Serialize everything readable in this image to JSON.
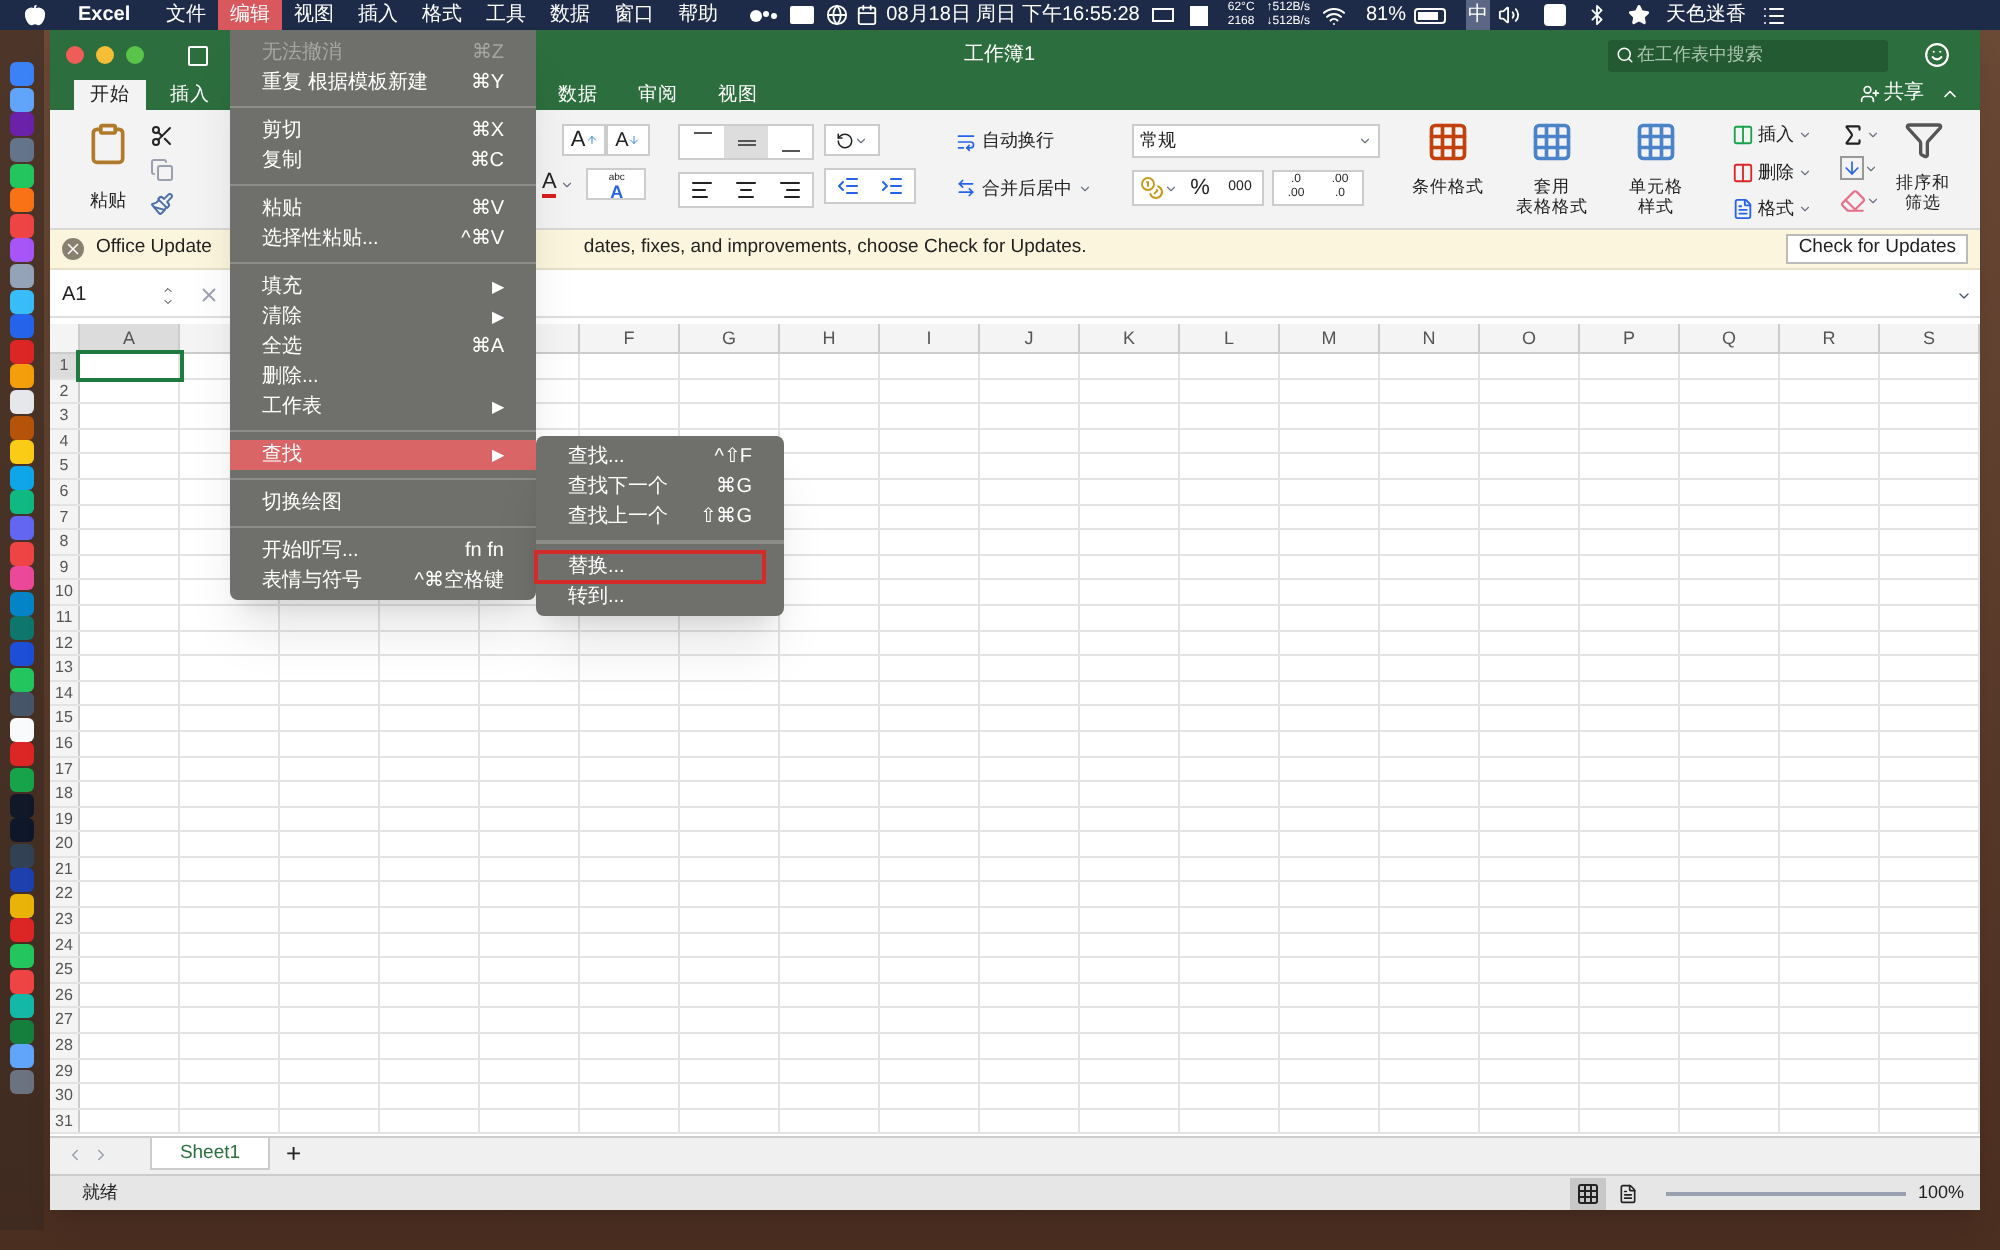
{
  "menubar": {
    "app": "Excel",
    "menus": [
      {
        "label": "文件",
        "selected": false
      },
      {
        "label": "编辑",
        "selected": true
      },
      {
        "label": "视图",
        "selected": false
      },
      {
        "label": "插入",
        "selected": false
      },
      {
        "label": "格式",
        "selected": false
      },
      {
        "label": "工具",
        "selected": false
      },
      {
        "label": "数据",
        "selected": false
      },
      {
        "label": "窗口",
        "selected": false
      },
      {
        "label": "帮助",
        "selected": false
      }
    ],
    "clock": "08月18日 周日 下午16:55:28",
    "temp": "62°C",
    "fan": "2168",
    "upload": "↑512B/s",
    "download": "↓512B/s",
    "battery": "81%",
    "input_method": "中",
    "user": "天色迷香"
  },
  "window": {
    "title": "工作簿1",
    "search_placeholder": "在工作表中搜索",
    "share": "共享"
  },
  "tabs": [
    {
      "label": "开始",
      "selected": true
    },
    {
      "label": "插入",
      "selected": false
    },
    {
      "label": "数据",
      "selected": false
    },
    {
      "label": "审阅",
      "selected": false
    },
    {
      "label": "视图",
      "selected": false
    }
  ],
  "ribbon": {
    "paste": "粘贴",
    "font_grow": "A",
    "font_shrink": "A",
    "font_color": "A",
    "abc_top": "abc",
    "abc_letter": "A",
    "wrap": "自动换行",
    "merge": "合并后居中",
    "number_format": "常规",
    "percent": "%",
    "thousands": "000",
    "decimals": [
      {
        "top": ".0",
        "bottom": ".00"
      },
      {
        "top": ".00",
        "bottom": ".0"
      }
    ],
    "conditional": "条件格式",
    "table_format": [
      "套用",
      "表格格式"
    ],
    "cell_styles": [
      "单元格",
      "样式"
    ],
    "insert": "插入",
    "delete": "删除",
    "format": "格式",
    "sort": [
      "排序和",
      "筛选"
    ]
  },
  "update_bar": {
    "title": "Office Update",
    "message": "dates, fixes, and improvements, choose Check for Updates.",
    "button": "Check for Updates"
  },
  "formula_bar": {
    "cell": "A1"
  },
  "columns": [
    {
      "label": "A",
      "selected": true
    },
    {},
    {},
    {},
    {},
    {
      "label": "F",
      "selected": false
    },
    {
      "label": "G",
      "selected": false
    },
    {
      "label": "H",
      "selected": false
    },
    {
      "label": "I",
      "selected": false
    },
    {
      "label": "J",
      "selected": false
    },
    {
      "label": "K",
      "selected": false
    },
    {
      "label": "L",
      "selected": false
    },
    {
      "label": "M",
      "selected": false
    },
    {
      "label": "N",
      "selected": false
    },
    {
      "label": "O",
      "selected": false
    },
    {
      "label": "P",
      "selected": false
    },
    {
      "label": "Q",
      "selected": false
    },
    {
      "label": "R",
      "selected": false
    },
    {
      "label": "S",
      "selected": false
    }
  ],
  "rows": [
    {
      "label": "1",
      "selected": true
    },
    {
      "label": "2",
      "selected": false
    },
    {
      "label": "3",
      "selected": false
    },
    {
      "label": "4",
      "selected": false
    },
    {
      "label": "5",
      "selected": false
    },
    {
      "label": "6",
      "selected": false
    },
    {
      "label": "7",
      "selected": false
    },
    {
      "label": "8",
      "selected": false
    },
    {
      "label": "9",
      "selected": false
    },
    {
      "label": "10",
      "selected": false
    },
    {
      "label": "11",
      "selected": false
    },
    {
      "label": "12",
      "selected": false
    },
    {
      "label": "13",
      "selected": false
    },
    {
      "label": "14",
      "selected": false
    },
    {
      "label": "15",
      "selected": false
    },
    {
      "label": "16",
      "selected": false
    },
    {
      "label": "17",
      "selected": false
    },
    {
      "label": "18",
      "selected": false
    },
    {
      "label": "19",
      "selected": false
    },
    {
      "label": "20",
      "selected": false
    },
    {
      "label": "21",
      "selected": false
    },
    {
      "label": "22",
      "selected": false
    },
    {
      "label": "23",
      "selected": false
    },
    {
      "label": "24",
      "selected": false
    },
    {
      "label": "25",
      "selected": false
    },
    {
      "label": "26",
      "selected": false
    },
    {
      "label": "27",
      "selected": false
    },
    {
      "label": "28",
      "selected": false
    },
    {
      "label": "29",
      "selected": false
    },
    {
      "label": "30",
      "selected": false
    },
    {
      "label": "31",
      "selected": false
    }
  ],
  "sheets": [
    {
      "label": "Sheet1",
      "selected": true
    }
  ],
  "add_sheet": "+",
  "status_bar": {
    "text": "就绪",
    "zoom": "100%"
  },
  "edit_menu": [
    {
      "kind": "item",
      "label": "无法撤消",
      "shortcut": "⌘Z",
      "disabled": true,
      "selected": false
    },
    {
      "kind": "item",
      "label": "重复 根据模板新建",
      "shortcut": "⌘Y",
      "disabled": false,
      "selected": false
    },
    {
      "kind": "separator"
    },
    {
      "kind": "item",
      "label": "剪切",
      "shortcut": "⌘X",
      "disabled": false,
      "selected": false
    },
    {
      "kind": "item",
      "label": "复制",
      "shortcut": "⌘C",
      "disabled": false,
      "selected": false
    },
    {
      "kind": "separator"
    },
    {
      "kind": "item",
      "label": "粘贴",
      "shortcut": "⌘V",
      "disabled": false,
      "selected": false
    },
    {
      "kind": "item",
      "label": "选择性粘贴...",
      "shortcut": "^⌘V",
      "disabled": false,
      "selected": false
    },
    {
      "kind": "separator"
    },
    {
      "kind": "item",
      "label": "填充",
      "disabled": false,
      "selected": false,
      "arrow": "▶"
    },
    {
      "kind": "item",
      "label": "清除",
      "disabled": false,
      "selected": false,
      "arrow": "▶"
    },
    {
      "kind": "item",
      "label": "全选",
      "shortcut": "⌘A",
      "disabled": false,
      "selected": false
    },
    {
      "kind": "item",
      "label": "删除...",
      "disabled": false,
      "selected": false
    },
    {
      "kind": "item",
      "label": "工作表",
      "disabled": false,
      "selected": false,
      "arrow": "▶"
    },
    {
      "kind": "separator"
    },
    {
      "kind": "item",
      "label": "查找",
      "disabled": false,
      "selected": true,
      "arrow": "▶"
    },
    {
      "kind": "separator"
    },
    {
      "kind": "item",
      "label": "切换绘图",
      "disabled": false,
      "selected": false
    },
    {
      "kind": "separator"
    },
    {
      "kind": "item",
      "label": "开始听写...",
      "shortcut": "fn fn",
      "disabled": false,
      "selected": false
    },
    {
      "kind": "item",
      "label": "表情与符号",
      "shortcut": "^⌘空格键",
      "disabled": false,
      "selected": false
    }
  ],
  "find_menu": [
    {
      "kind": "item",
      "label": "查找...",
      "shortcut": "^⇧F",
      "outlined": false
    },
    {
      "kind": "item",
      "label": "查找下一个",
      "shortcut": "⌘G",
      "outlined": false
    },
    {
      "kind": "item",
      "label": "查找上一个",
      "shortcut": "⇧⌘G",
      "outlined": false
    },
    {
      "kind": "separator"
    },
    {
      "kind": "item",
      "label": "替换...",
      "outlined": true
    },
    {
      "kind": "item",
      "label": "转到...",
      "outlined": false
    }
  ]
}
